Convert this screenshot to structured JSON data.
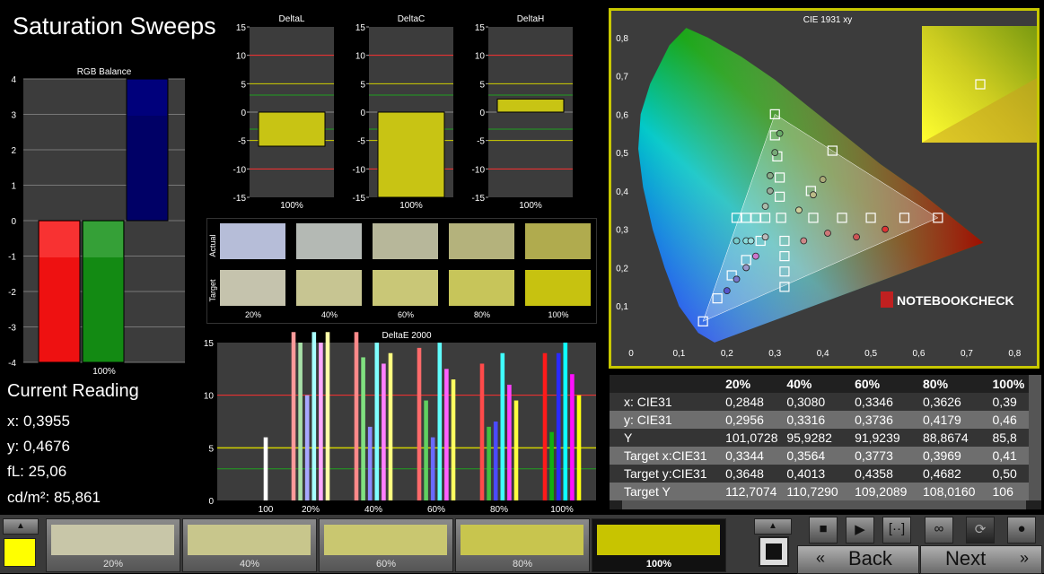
{
  "title": "Saturation Sweeps",
  "rgb_balance": {
    "title": "RGB Balance",
    "yticks": [
      "4",
      "3",
      "2",
      "1",
      "0",
      "-1",
      "-2",
      "-3",
      "-4"
    ],
    "xlabel": "100%",
    "bars": [
      {
        "value": -4.0,
        "color": "#ff4a4a",
        "color2": "#ee1111"
      },
      {
        "value": -4.0,
        "color": "#4caf50",
        "color2": "#138a13"
      },
      {
        "value": 4.0,
        "color": "#000088",
        "color2": "#000066"
      }
    ]
  },
  "delta_charts": [
    {
      "title": "DeltaL",
      "value": -6.0,
      "xlabel": "100%"
    },
    {
      "title": "DeltaC",
      "value": -15.0,
      "xlabel": "100%"
    },
    {
      "title": "DeltaH",
      "value": 2.3,
      "xlabel": "100%"
    }
  ],
  "delta_yticks": [
    "15",
    "10",
    "5",
    "0",
    "-5",
    "-10",
    "-15"
  ],
  "swatch_panel": {
    "actual_label": "Actual",
    "target_label": "Target",
    "labels": [
      "20%",
      "40%",
      "60%",
      "80%",
      "100%"
    ],
    "actual": [
      "#b6bdd8",
      "#b4b9b4",
      "#b7b79a",
      "#b4b27c",
      "#b0ab4e"
    ],
    "target": [
      "#c5c3ad",
      "#c7c592",
      "#c9c777",
      "#c7c55a",
      "#c7c210"
    ]
  },
  "deltae": {
    "title": "DeltaE 2000",
    "yticks": [
      "15",
      "10",
      "5",
      "0"
    ],
    "xlabels": [
      "100",
      "20%",
      "40%",
      "60%",
      "80%",
      "100%"
    ]
  },
  "cie": {
    "title": "CIE 1931 xy",
    "xticks": [
      "0",
      "0,1",
      "0,2",
      "0,3",
      "0,4",
      "0,5",
      "0,6",
      "0,7",
      "0,8"
    ],
    "yticks": [
      "0,8",
      "0,7",
      "0,6",
      "0,5",
      "0,4",
      "0,3",
      "0,2",
      "0,1"
    ],
    "logo": "NOTEBOOKCHECK"
  },
  "current": {
    "heading": "Current Reading",
    "x": "x: 0,3955",
    "y": "y: 0,4676",
    "fl": "fL: 25,06",
    "cd": "cd/m²: 85,861"
  },
  "table": {
    "headers": [
      "",
      "20%",
      "40%",
      "60%",
      "80%",
      "100%"
    ],
    "rows": [
      [
        "x: CIE31",
        "0,2848",
        "0,3080",
        "0,3346",
        "0,3626",
        "0,39"
      ],
      [
        "y: CIE31",
        "0,2956",
        "0,3316",
        "0,3736",
        "0,4179",
        "0,46"
      ],
      [
        "Y",
        "101,0728",
        "95,9282",
        "91,9239",
        "88,8674",
        "85,8"
      ],
      [
        "Target x:CIE31",
        "0,3344",
        "0,3564",
        "0,3773",
        "0,3969",
        "0,41"
      ],
      [
        "Target y:CIE31",
        "0,3648",
        "0,4013",
        "0,4358",
        "0,4682",
        "0,50"
      ],
      [
        "Target Y",
        "112,7074",
        "110,7290",
        "109,2089",
        "108,0160",
        "106"
      ]
    ]
  },
  "bottom": {
    "current_color": "#ffff00",
    "swatches": [
      {
        "label": "20%",
        "color": "#c8c6a8"
      },
      {
        "label": "40%",
        "color": "#c8c68c"
      },
      {
        "label": "60%",
        "color": "#c9c770"
      },
      {
        "label": "80%",
        "color": "#c8c54e"
      },
      {
        "label": "100%",
        "color": "#c8c400"
      }
    ],
    "back_label": "Back",
    "next_label": "Next"
  }
}
